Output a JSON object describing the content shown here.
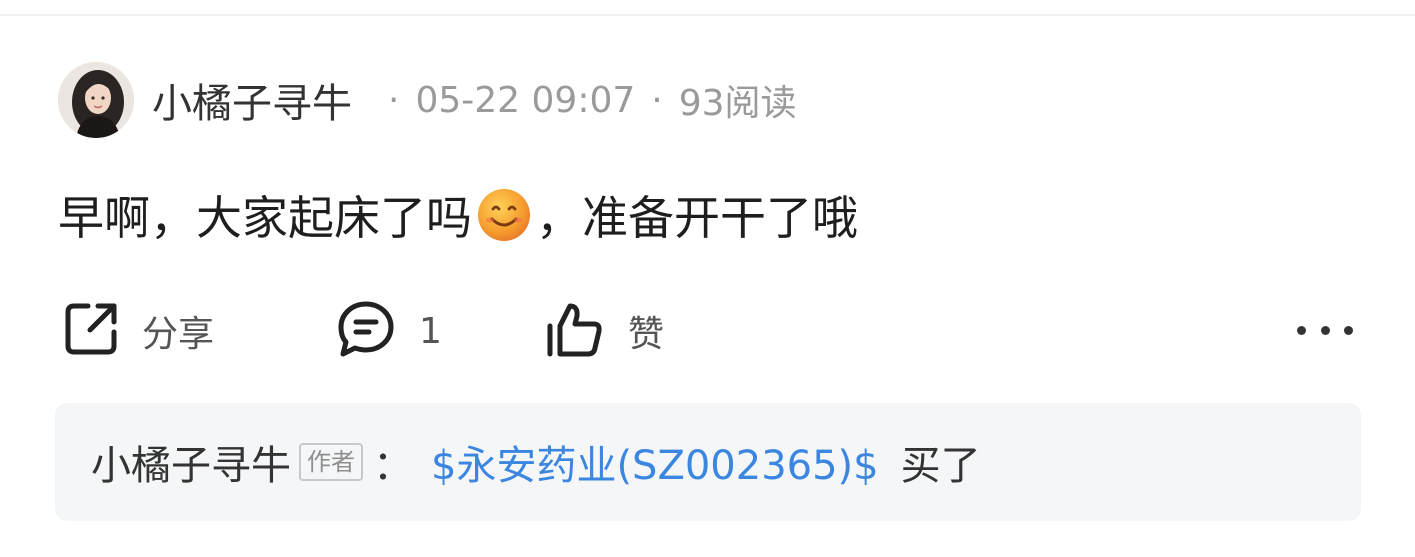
{
  "post": {
    "author": "小橘子寻牛",
    "time": "05-22 09:07",
    "reads": "93阅读",
    "separator": "·",
    "content_before": "早啊，大家起床了吗",
    "emoji": "smile-emoji",
    "content_after": "，准备开干了哦"
  },
  "actions": {
    "share_label": "分享",
    "comment_count": "1",
    "like_label": "赞",
    "icons": [
      "share-icon",
      "comment-icon",
      "thumbs-up-icon",
      "more-icon"
    ]
  },
  "reply": {
    "author": "小橘子寻牛",
    "author_tag": "作者",
    "colon": "：",
    "stock": "$永安药业(SZ002365)$",
    "text": "买了"
  },
  "colors": {
    "link": "#3a86e0",
    "muted": "#9a9a9a",
    "reply_bg": "#f5f6f8"
  }
}
